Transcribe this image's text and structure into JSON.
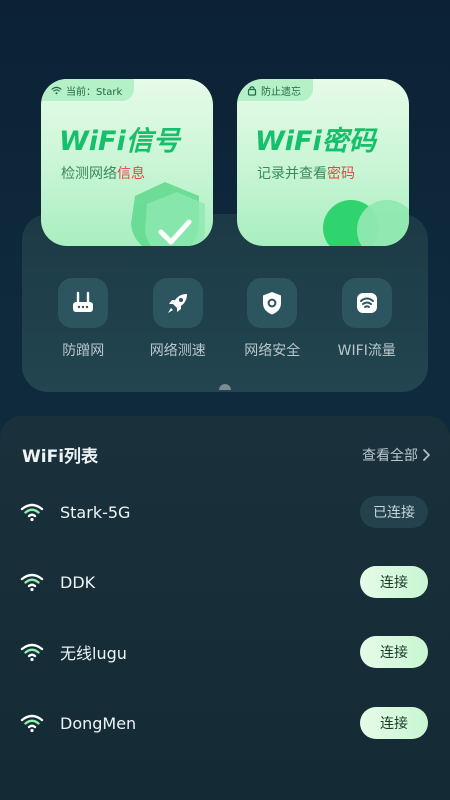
{
  "cards": [
    {
      "tag": "当前：Stark",
      "tag_icon": "wifi-icon",
      "title": "WiFi信号",
      "sub_plain": "检测网络",
      "sub_hl": "信息"
    },
    {
      "tag": "防止遗忘",
      "tag_icon": "lock-icon",
      "title": "WiFi密码",
      "sub_plain": "记录并查看",
      "sub_hl": "密码"
    }
  ],
  "actions": [
    {
      "label": "防蹭网",
      "icon": "router-icon"
    },
    {
      "label": "网络测速",
      "icon": "rocket-icon"
    },
    {
      "label": "网络安全",
      "icon": "shield-icon"
    },
    {
      "label": "WIFI流量",
      "icon": "wifi-traffic-icon"
    }
  ],
  "wifi_list": {
    "title": "WiFi列表",
    "view_all": "查看全部",
    "items": [
      {
        "ssid": "Stark-5G",
        "action": "已连接",
        "state": "connected"
      },
      {
        "ssid": "DDK",
        "action": "连接",
        "state": "available"
      },
      {
        "ssid": "无线lugu",
        "action": "连接",
        "state": "available"
      },
      {
        "ssid": "DongMen",
        "action": "连接",
        "state": "available"
      }
    ]
  },
  "colors": {
    "accent_green": "#14c06a",
    "highlight_red": "#e24848",
    "background": "#0f2a3d"
  }
}
